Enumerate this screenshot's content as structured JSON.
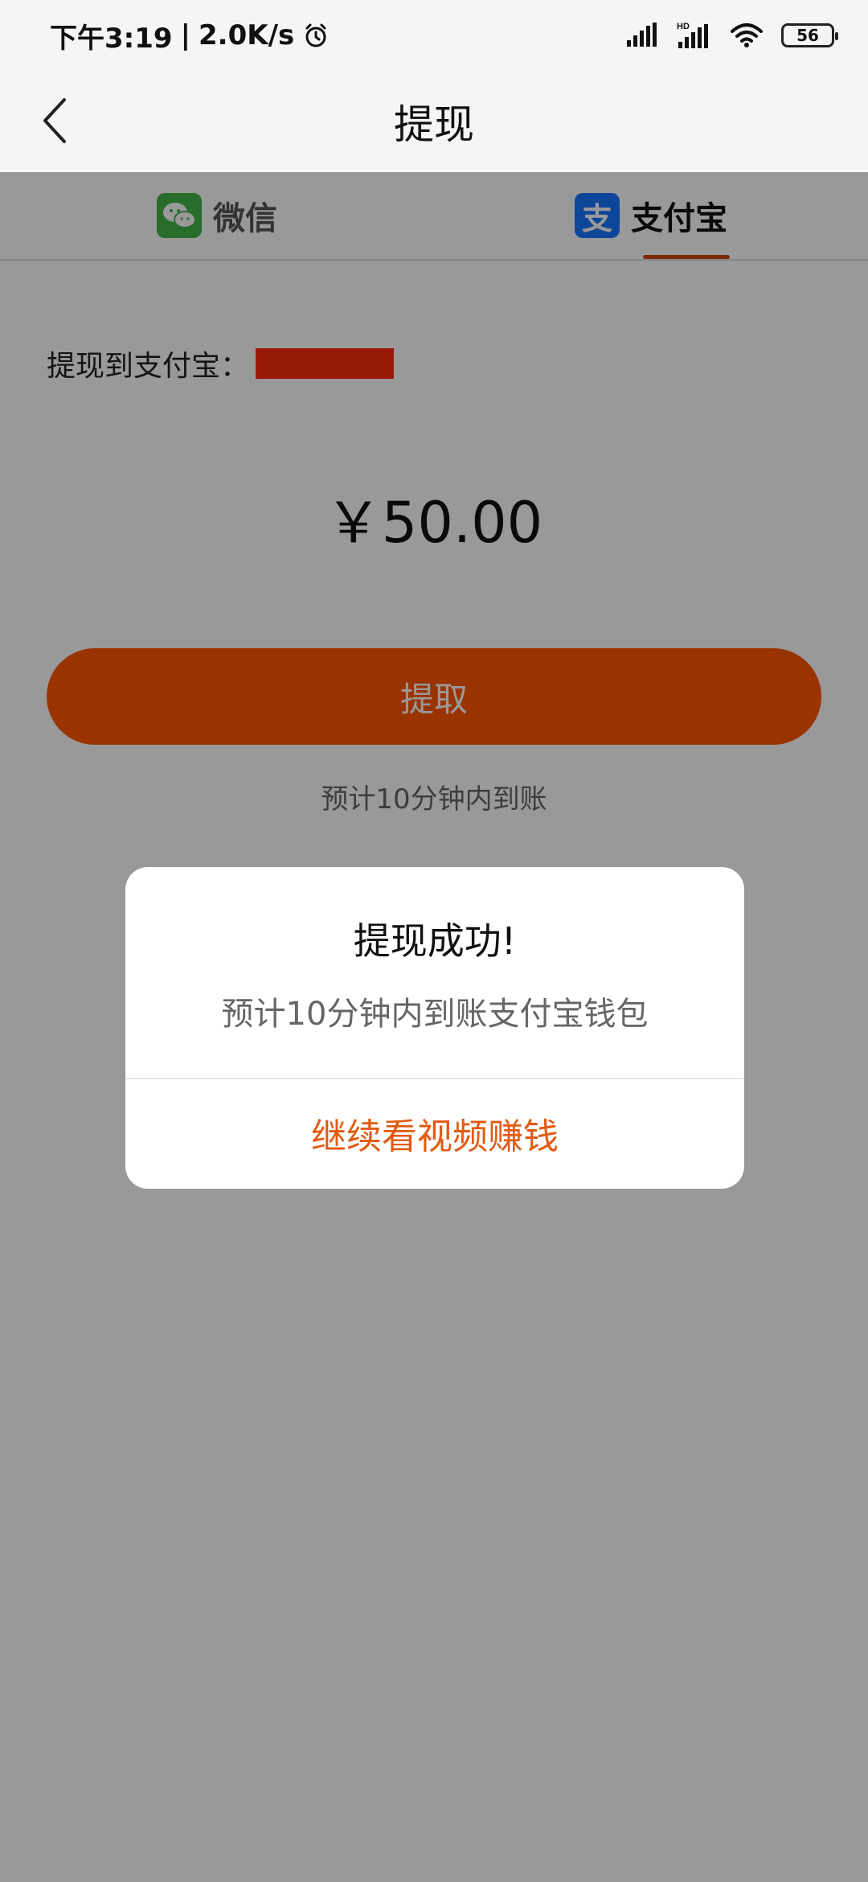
{
  "status_bar": {
    "time": "下午3:19",
    "network_speed": "2.0K/s",
    "alarm_icon": "alarm-icon",
    "signal_icon": "cell-signal-icon",
    "hd_signal_icon": "hd-signal-icon",
    "hd_label": "HD",
    "wifi_icon": "wifi-icon",
    "battery_level": "56"
  },
  "nav": {
    "back_icon": "chevron-left-icon",
    "title": "提现"
  },
  "tabs": [
    {
      "label": "微信",
      "icon": "wechat-icon",
      "active": false
    },
    {
      "label": "支付宝",
      "icon": "alipay-icon",
      "icon_glyph": "支",
      "active": true
    }
  ],
  "withdraw": {
    "target_label": "提现到支付宝：",
    "amount": "￥50.00",
    "button_label": "提取",
    "eta_text": "预计10分钟内到账"
  },
  "dialog": {
    "title": "提现成功!",
    "message": "预计10分钟内到账支付宝钱包",
    "action_label": "继续看视频赚钱"
  },
  "colors": {
    "accent_orange": "#FF5500",
    "dialog_action": "#E25A12",
    "redaction": "#FF2A10",
    "wechat_green": "#44B549",
    "alipay_blue": "#1676FF"
  }
}
